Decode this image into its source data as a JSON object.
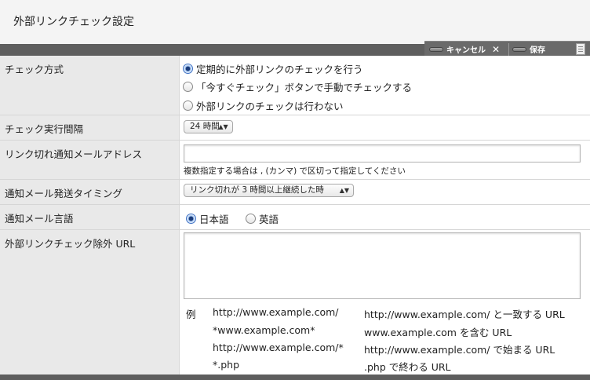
{
  "header": {
    "title": "外部リンクチェック設定"
  },
  "toolbar": {
    "cancel_label": "キャンセル",
    "cancel_x": "✕",
    "save_label": "保存"
  },
  "rows": {
    "method": {
      "label": "チェック方式",
      "options": [
        "定期的に外部リンクのチェックを行う",
        "「今すぐチェック」ボタンで手動でチェックする",
        "外部リンクのチェックは行わない"
      ],
      "selected_index": 0
    },
    "interval": {
      "label": "チェック実行間隔",
      "value": "24 時間"
    },
    "email": {
      "label": "リンク切れ通知メールアドレス",
      "value": "",
      "note": "複数指定する場合は , (カンマ) で区切って指定してください"
    },
    "timing": {
      "label": "通知メール発送タイミング",
      "value": "リンク切れが 3 時間以上継続した時"
    },
    "language": {
      "label": "通知メール言語",
      "options": [
        "日本語",
        "英語"
      ],
      "selected_index": 0
    },
    "exclude": {
      "label": "外部リンクチェック除外 URL",
      "value": "",
      "example_label": "例",
      "examples": [
        {
          "pattern": "http://www.example.com/",
          "desc": "http://www.example.com/ と一致する URL"
        },
        {
          "pattern": "*www.example.com*",
          "desc": "www.example.com を含む URL"
        },
        {
          "pattern": "http://www.example.com/*",
          "desc": "http://www.example.com/ で始まる URL"
        },
        {
          "pattern": "*.php",
          "desc": ".php で終わる URL"
        }
      ]
    }
  }
}
